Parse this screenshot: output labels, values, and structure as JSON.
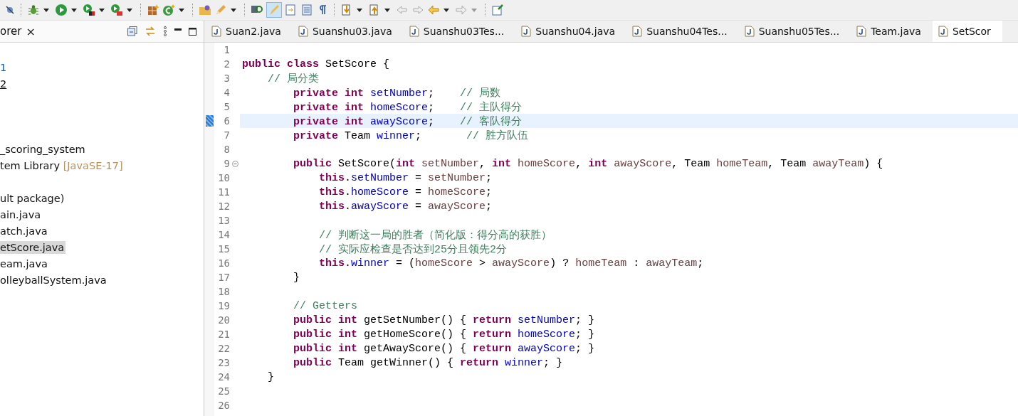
{
  "explorer": {
    "tab_label": "orer",
    "close": "×",
    "tree": [
      {
        "kind": "blank",
        "selected": false
      },
      {
        "kind": "link",
        "text": "1",
        "selected": false
      },
      {
        "kind": "underlined",
        "text": "2",
        "selected": false
      },
      {
        "kind": "blank",
        "selected": false
      },
      {
        "kind": "blank",
        "selected": false
      },
      {
        "kind": "blank",
        "selected": false
      },
      {
        "kind": "text",
        "text": "_scoring_system",
        "selected": false
      },
      {
        "kind": "library",
        "text": "tem Library",
        "decoration": "[JavaSE-17]",
        "selected": false
      },
      {
        "kind": "blank",
        "selected": false
      },
      {
        "kind": "text",
        "text": "ult package)",
        "selected": false
      },
      {
        "kind": "text",
        "text": "ain.java",
        "selected": false
      },
      {
        "kind": "text",
        "text": "atch.java",
        "selected": false
      },
      {
        "kind": "text",
        "text": "etScore.java",
        "selected": true
      },
      {
        "kind": "text",
        "text": "eam.java",
        "selected": false
      },
      {
        "kind": "text",
        "text": "olleyballSystem.java",
        "selected": false
      }
    ]
  },
  "editor_tabs": [
    {
      "label": "Suan2.java",
      "selected": false
    },
    {
      "label": "Suanshu03.java",
      "selected": false
    },
    {
      "label": "Suanshu03Tes...",
      "selected": false
    },
    {
      "label": "Suanshu04.java",
      "selected": false
    },
    {
      "label": "Suanshu04Tes...",
      "selected": false
    },
    {
      "label": "Suanshu05Tes...",
      "selected": false
    },
    {
      "label": "Team.java",
      "selected": false
    },
    {
      "label": "SetScor",
      "selected": true
    }
  ],
  "code_lines": [
    {
      "number": "1",
      "current": false,
      "foldable": false
    },
    {
      "number": "2",
      "current": false,
      "foldable": false,
      "tokens": [
        {
          "kind": "kw",
          "text": "public "
        },
        {
          "kind": "kw",
          "text": "class"
        },
        {
          "kind": "plain",
          "text": " SetScore {"
        }
      ]
    },
    {
      "number": "3",
      "current": false,
      "foldable": false,
      "tokens": [
        {
          "kind": "comment",
          "text": "    // 局分类"
        }
      ]
    },
    {
      "number": "4",
      "current": false,
      "foldable": false,
      "tokens": [
        {
          "kind": "kw",
          "text": "        private int "
        },
        {
          "kind": "field",
          "text": "setNumber"
        },
        {
          "kind": "plain",
          "text": ";    "
        },
        {
          "kind": "comment",
          "text": "// 局数"
        }
      ]
    },
    {
      "number": "5",
      "current": false,
      "foldable": false,
      "tokens": [
        {
          "kind": "kw",
          "text": "        private int "
        },
        {
          "kind": "field",
          "text": "homeScore"
        },
        {
          "kind": "plain",
          "text": ";    "
        },
        {
          "kind": "comment",
          "text": "// 主队得分"
        }
      ]
    },
    {
      "number": "6",
      "current": true,
      "foldable": false,
      "tokens": [
        {
          "kind": "kw",
          "text": "        private int "
        },
        {
          "kind": "field",
          "text": "awayScore"
        },
        {
          "kind": "plain",
          "text": ";    "
        },
        {
          "kind": "comment",
          "text": "// 客队得分"
        }
      ]
    },
    {
      "number": "7",
      "current": false,
      "foldable": false,
      "tokens": [
        {
          "kind": "kw",
          "text": "        private"
        },
        {
          "kind": "plain",
          "text": " Team "
        },
        {
          "kind": "field",
          "text": "winner"
        },
        {
          "kind": "plain",
          "text": ";       "
        },
        {
          "kind": "comment",
          "text": "// 胜方队伍"
        }
      ]
    },
    {
      "number": "8",
      "current": false,
      "foldable": false
    },
    {
      "number": "9",
      "current": false,
      "foldable": true,
      "tokens": [
        {
          "kind": "kw",
          "text": "        public"
        },
        {
          "kind": "plain",
          "text": " SetScore("
        },
        {
          "kind": "kw",
          "text": "int"
        },
        {
          "kind": "var",
          "text": " setNumber"
        },
        {
          "kind": "plain",
          "text": ", "
        },
        {
          "kind": "kw",
          "text": "int"
        },
        {
          "kind": "var",
          "text": " homeScore"
        },
        {
          "kind": "plain",
          "text": ", "
        },
        {
          "kind": "kw",
          "text": "int"
        },
        {
          "kind": "var",
          "text": " awayScore"
        },
        {
          "kind": "plain",
          "text": ", Team "
        },
        {
          "kind": "var",
          "text": "homeTeam"
        },
        {
          "kind": "plain",
          "text": ", Team "
        },
        {
          "kind": "var",
          "text": "awayTeam"
        },
        {
          "kind": "plain",
          "text": ") {"
        }
      ]
    },
    {
      "number": "10",
      "current": false,
      "foldable": false,
      "tokens": [
        {
          "kind": "kw",
          "text": "            this"
        },
        {
          "kind": "plain",
          "text": "."
        },
        {
          "kind": "field",
          "text": "setNumber"
        },
        {
          "kind": "plain",
          "text": " = "
        },
        {
          "kind": "var",
          "text": "setNumber"
        },
        {
          "kind": "plain",
          "text": ";"
        }
      ]
    },
    {
      "number": "11",
      "current": false,
      "foldable": false,
      "tokens": [
        {
          "kind": "kw",
          "text": "            this"
        },
        {
          "kind": "plain",
          "text": "."
        },
        {
          "kind": "field",
          "text": "homeScore"
        },
        {
          "kind": "plain",
          "text": " = "
        },
        {
          "kind": "var",
          "text": "homeScore"
        },
        {
          "kind": "plain",
          "text": ";"
        }
      ]
    },
    {
      "number": "12",
      "current": false,
      "foldable": false,
      "tokens": [
        {
          "kind": "kw",
          "text": "            this"
        },
        {
          "kind": "plain",
          "text": "."
        },
        {
          "kind": "field",
          "text": "awayScore"
        },
        {
          "kind": "plain",
          "text": " = "
        },
        {
          "kind": "var",
          "text": "awayScore"
        },
        {
          "kind": "plain",
          "text": ";"
        }
      ]
    },
    {
      "number": "13",
      "current": false,
      "foldable": false
    },
    {
      "number": "14",
      "current": false,
      "foldable": false,
      "tokens": [
        {
          "kind": "comment",
          "text": "            // 判断这一局的胜者（简化版：得分高的获胜）"
        }
      ]
    },
    {
      "number": "15",
      "current": false,
      "foldable": false,
      "tokens": [
        {
          "kind": "comment",
          "text": "            // 实际应检查是否达到25分且领先2分"
        }
      ]
    },
    {
      "number": "16",
      "current": false,
      "foldable": false,
      "tokens": [
        {
          "kind": "kw",
          "text": "            this"
        },
        {
          "kind": "plain",
          "text": "."
        },
        {
          "kind": "field",
          "text": "winner"
        },
        {
          "kind": "plain",
          "text": " = ("
        },
        {
          "kind": "var",
          "text": "homeScore"
        },
        {
          "kind": "plain",
          "text": " > "
        },
        {
          "kind": "var",
          "text": "awayScore"
        },
        {
          "kind": "plain",
          "text": ") ? "
        },
        {
          "kind": "var",
          "text": "homeTeam"
        },
        {
          "kind": "plain",
          "text": " : "
        },
        {
          "kind": "var",
          "text": "awayTeam"
        },
        {
          "kind": "plain",
          "text": ";"
        }
      ]
    },
    {
      "number": "17",
      "current": false,
      "foldable": false,
      "tokens": [
        {
          "kind": "plain",
          "text": "        }"
        }
      ]
    },
    {
      "number": "18",
      "current": false,
      "foldable": false
    },
    {
      "number": "19",
      "current": false,
      "foldable": false,
      "tokens": [
        {
          "kind": "comment",
          "text": "        // Getters"
        }
      ]
    },
    {
      "number": "20",
      "current": false,
      "foldable": false,
      "tokens": [
        {
          "kind": "kw",
          "text": "        public int"
        },
        {
          "kind": "plain",
          "text": " getSetNumber() { "
        },
        {
          "kind": "kw",
          "text": "return "
        },
        {
          "kind": "field",
          "text": "setNumber"
        },
        {
          "kind": "plain",
          "text": "; }"
        }
      ]
    },
    {
      "number": "21",
      "current": false,
      "foldable": false,
      "tokens": [
        {
          "kind": "kw",
          "text": "        public int"
        },
        {
          "kind": "plain",
          "text": " getHomeScore() { "
        },
        {
          "kind": "kw",
          "text": "return "
        },
        {
          "kind": "field",
          "text": "homeScore"
        },
        {
          "kind": "plain",
          "text": "; }"
        }
      ]
    },
    {
      "number": "22",
      "current": false,
      "foldable": false,
      "tokens": [
        {
          "kind": "kw",
          "text": "        public int"
        },
        {
          "kind": "plain",
          "text": " getAwayScore() { "
        },
        {
          "kind": "kw",
          "text": "return "
        },
        {
          "kind": "field",
          "text": "awayScore"
        },
        {
          "kind": "plain",
          "text": "; }"
        }
      ]
    },
    {
      "number": "23",
      "current": false,
      "foldable": false,
      "tokens": [
        {
          "kind": "kw",
          "text": "        public"
        },
        {
          "kind": "plain",
          "text": " Team getWinner() { "
        },
        {
          "kind": "kw",
          "text": "return "
        },
        {
          "kind": "field",
          "text": "winner"
        },
        {
          "kind": "plain",
          "text": "; }"
        }
      ]
    },
    {
      "number": "24",
      "current": false,
      "foldable": false,
      "tokens": [
        {
          "kind": "plain",
          "text": "    }"
        }
      ]
    },
    {
      "number": "25",
      "current": false,
      "foldable": false
    },
    {
      "number": "26",
      "current": false,
      "foldable": false
    }
  ]
}
